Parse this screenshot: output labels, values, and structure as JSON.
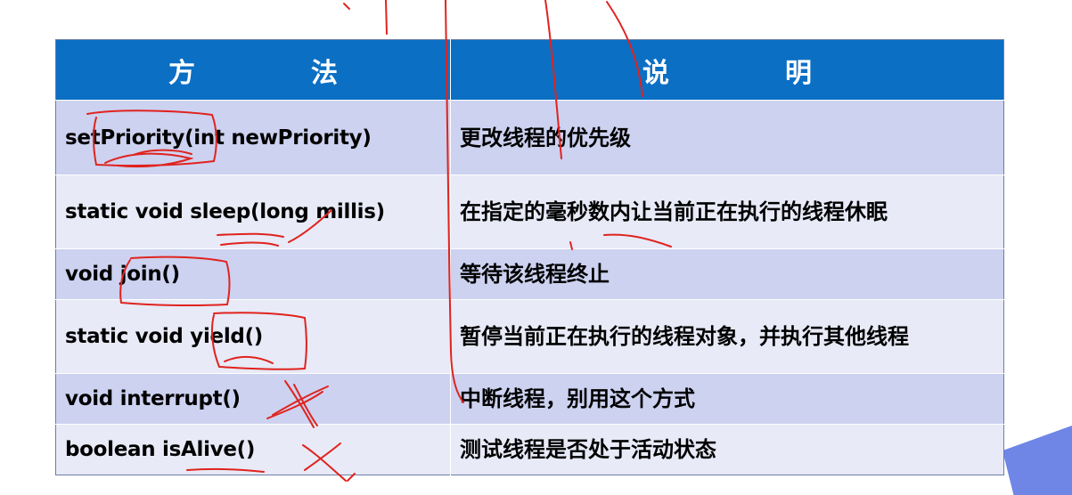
{
  "table": {
    "headers": [
      "方　法",
      "说　明"
    ],
    "rows": [
      {
        "method": "setPriority(int  newPriority)",
        "description": "更改线程的优先级"
      },
      {
        "method": "static void sleep(long millis)",
        "description": "在指定的毫秒数内让当前正在执行的线程休眠"
      },
      {
        "method": "void join()",
        "description": "等待该线程终止"
      },
      {
        "method": "static void yield()",
        "description": "暂停当前正在执行的线程对象，并执行其他线程"
      },
      {
        "method": "void interrupt()",
        "description": "中断线程，别用这个方式"
      },
      {
        "method": "boolean isAlive()",
        "description": "测试线程是否处于活动状态"
      }
    ]
  },
  "colors": {
    "header_bg": "#0b6fc4",
    "row_odd_bg": "#cdd2f0",
    "row_even_bg": "#e8eaf7",
    "annotation_ink": "#e0231f",
    "corner_accent": "#6f86e6"
  }
}
